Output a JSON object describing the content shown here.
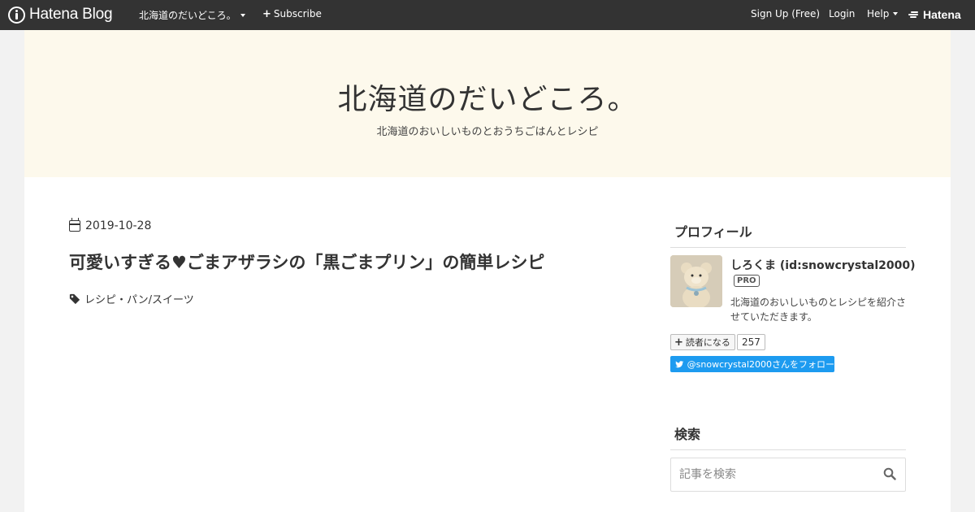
{
  "topbar": {
    "logo_text": "Hatena Blog",
    "blog_name": "北海道のだいどころ。",
    "subscribe_label": "Subscribe",
    "signup_label": "Sign Up (Free)",
    "login_label": "Login",
    "help_label": "Help",
    "hatena_label": "Hatena"
  },
  "header": {
    "title": "北海道のだいどころ。",
    "description": "北海道のおいしいものとおうちごはんとレシピ"
  },
  "entry": {
    "date": "2019-10-28",
    "title": "可愛いすぎる♥ごまアザラシの「黒ごまプリン」の簡単レシピ",
    "tags": "レシピ・パン/スイーツ"
  },
  "sidebar": {
    "profile_heading": "プロフィール",
    "profile_name": "しろくま (id:snowcrystal2000)",
    "pro_badge": "PRO",
    "profile_description": "北海道のおいしいものとレシピを紹介させていただきます。",
    "reader_label": "読者になる",
    "reader_count": "257",
    "twitter_label": "@snowcrystal2000さんをフォロー",
    "search_heading": "検索",
    "search_placeholder": "記事を検索"
  },
  "colors": {
    "topbar_bg": "#333333",
    "header_bg": "#fdf9ec",
    "twitter_blue": "#1d9bf0"
  }
}
